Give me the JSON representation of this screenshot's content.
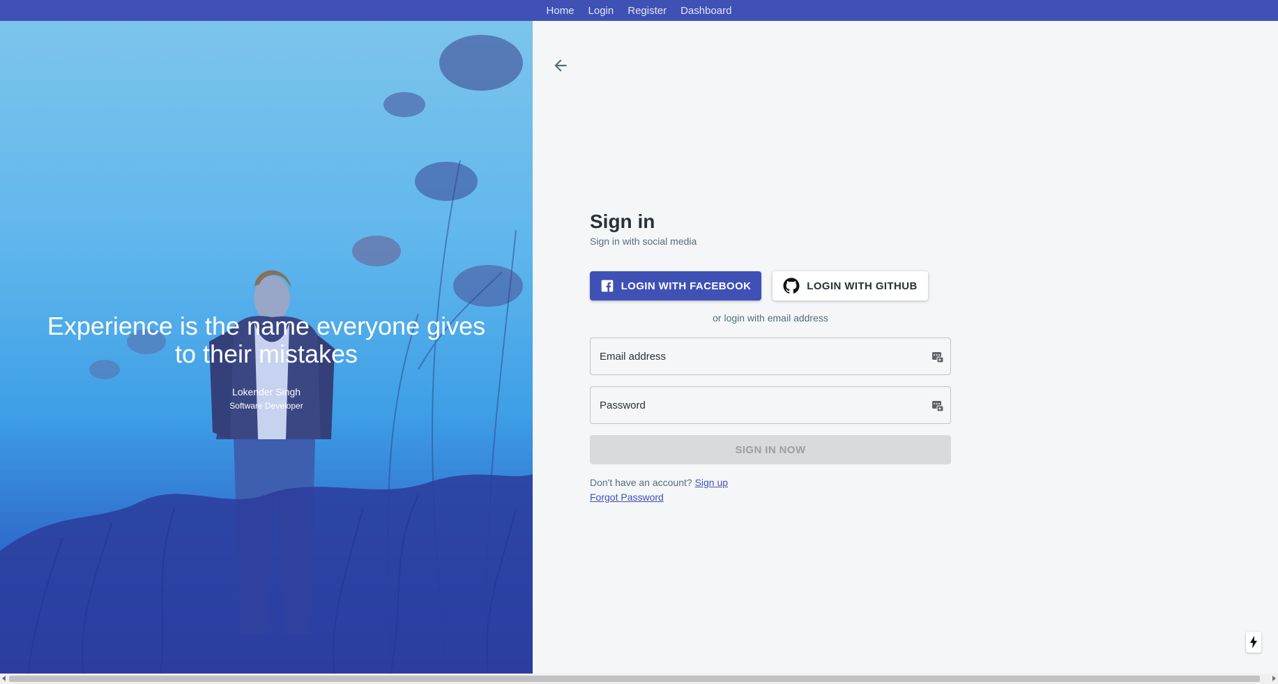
{
  "nav": {
    "items": [
      "Home",
      "Login",
      "Register",
      "Dashboard"
    ]
  },
  "hero": {
    "quote_line1": "Experience is the name everyone gives",
    "quote_line2": "to their mistakes",
    "author": "Lokender Singh",
    "role": "Software Developer"
  },
  "form": {
    "title": "Sign in",
    "subtitle": "Sign in with social media",
    "facebook_label": "LOGIN WITH FACEBOOK",
    "github_label": "LOGIN WITH GITHUB",
    "or_text": "or login with email address",
    "email_placeholder": "Email address",
    "password_placeholder": "Password",
    "signin_label": "SIGN IN NOW",
    "no_account_text": "Don't have an account?",
    "signup_link": "Sign up",
    "forgot_link": "Forgot Password"
  },
  "colors": {
    "primary": "#3f51b5",
    "background": "#f4f6f8",
    "text": "#263238",
    "muted": "#546e7a",
    "disabled": "#d9dadc"
  },
  "icons": {
    "back": "arrow-left-icon",
    "facebook": "facebook-icon",
    "github": "github-icon",
    "keychain": "keychain-icon",
    "bolt": "lightning-bolt-icon"
  }
}
